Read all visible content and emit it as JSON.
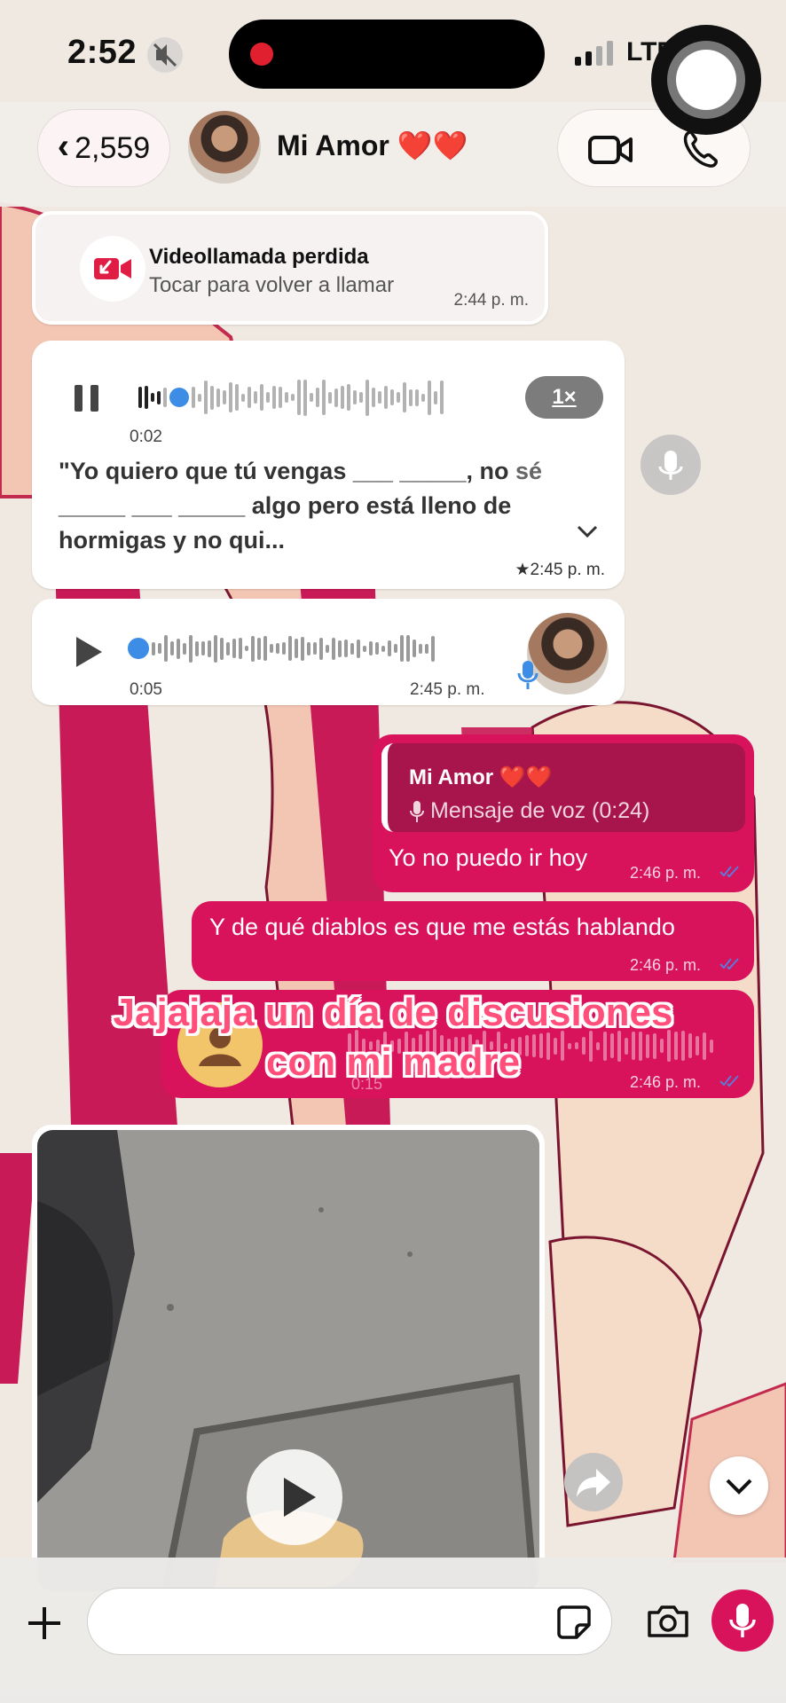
{
  "status_bar": {
    "time": "2:52",
    "network": "LTE"
  },
  "header": {
    "back_count": "2,559",
    "contact_name": "Mi Amor ❤️❤️"
  },
  "messages": {
    "missed_call": {
      "title": "Videollamada perdida",
      "subtitle": "Tocar para volver a llamar",
      "time": "2:44 p. m."
    },
    "voice_note_1": {
      "elapsed": "0:02",
      "speed": "1×",
      "transcript_main": "\"Yo quiero que tú vengas ___ _____, no ",
      "transcript_muted": "sé",
      "transcript_rest": "_____ ___ _____ algo pero está lleno de hormigas y no qui...",
      "time": "★2:45 p. m."
    },
    "voice_note_2": {
      "duration": "0:05",
      "time": "2:45 p. m."
    },
    "reply": {
      "quoted_name": "Mi Amor ❤️❤️",
      "quoted_text": "Mensaje de voz (0:24)",
      "text": "Yo no puedo ir hoy",
      "time": "2:46 p. m."
    },
    "outgoing_2": {
      "text": "Y de qué diablos es que me estás hablando",
      "time": "2:46 p. m."
    },
    "outgoing_voice": {
      "duration": "0:15",
      "time": "2:46 p. m."
    }
  },
  "overlay_caption": {
    "line1": "Jajajaja un día de discusiones",
    "line2": "con mi madre"
  },
  "composer": {
    "placeholder": ""
  },
  "colors": {
    "outgoing_bubble": "#d8125b",
    "reply_quote": "#a8154c",
    "caption": "#ff4f7a",
    "read_ticks": "#5b7bd8"
  }
}
